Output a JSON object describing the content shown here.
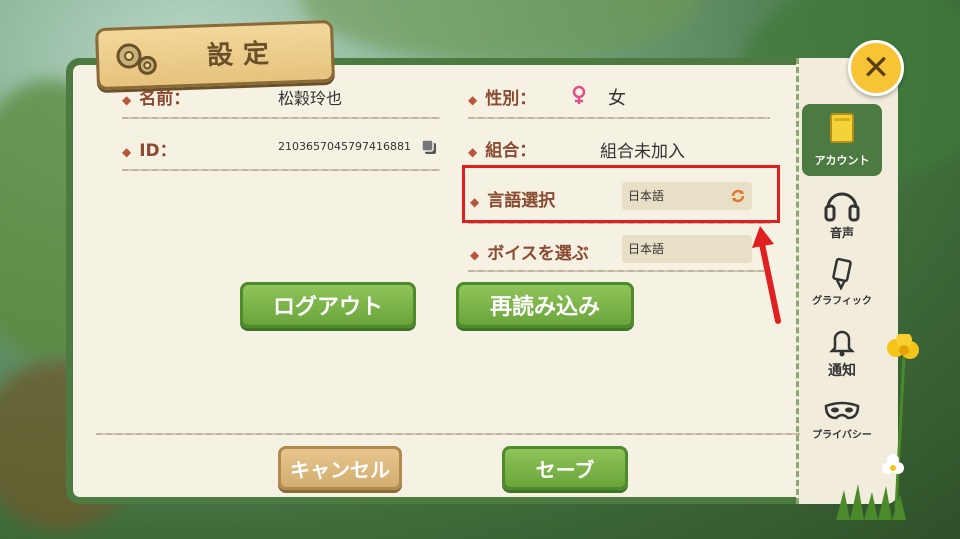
{
  "header": {
    "title": "設定",
    "icon": "gear-icon"
  },
  "close": {
    "label": "✕",
    "icon": "close-icon"
  },
  "left": {
    "name": {
      "label": "名前：",
      "value": "松穀玲也"
    },
    "id": {
      "label": "ID：",
      "value": "2103657045797416881",
      "copy_icon": "copy-icon"
    }
  },
  "right": {
    "gender": {
      "label": "性別：",
      "value": "女",
      "icon": "female-icon"
    },
    "guild": {
      "label": "組合：",
      "value": "組合未加入"
    },
    "language": {
      "label": "言語選択",
      "value": "日本語",
      "icon": "refresh-icon"
    },
    "voice": {
      "label": "ボイスを選ぶ",
      "value": "日本語"
    }
  },
  "buttons": {
    "logout": "ログアウト",
    "reload": "再読み込み",
    "cancel": "キャンセル",
    "save": "セーブ"
  },
  "tabs": [
    {
      "label": "アカウント",
      "icon": "account-icon",
      "active": true
    },
    {
      "label": "音声",
      "icon": "headphones-icon"
    },
    {
      "label": "グラフィック",
      "icon": "brush-icon"
    },
    {
      "label": "通知",
      "icon": "bell-icon"
    },
    {
      "label": "プライバシー",
      "icon": "mask-icon"
    }
  ],
  "colors": {
    "panel_border": "#4c7a40",
    "button_green": "#6aa53b",
    "highlight": "#e02020",
    "label": "#8b4a32"
  }
}
